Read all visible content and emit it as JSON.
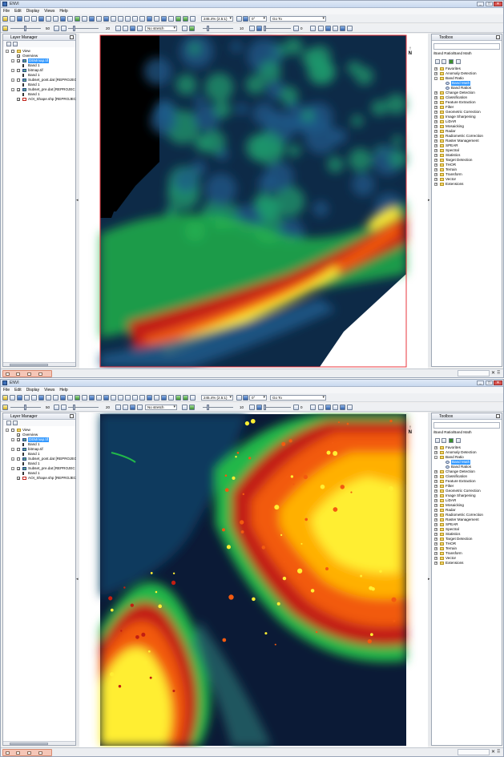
{
  "app": {
    "title": "ENVI",
    "menu": [
      "File",
      "Edit",
      "Display",
      "Views",
      "Help"
    ]
  },
  "toolbar": {
    "zoom": "245.4% (2.5:1)",
    "rotation": "0°",
    "goto_label": "Go To",
    "brightness": "50",
    "contrast": "20",
    "stretch": "No stretch",
    "sharpen": "10",
    "transparency": "0"
  },
  "layer_manager": {
    "title": "Layer Manager",
    "tree": [
      {
        "level": 0,
        "label": "View",
        "icon": "folder-icon",
        "expand": "-",
        "check": false
      },
      {
        "level": 1,
        "label": "Overview",
        "icon": "",
        "expand": "",
        "check": true
      },
      {
        "level": 1,
        "label": "DEMmap.tif",
        "icon": "raster-icon",
        "expand": "-",
        "check": true,
        "selected": true
      },
      {
        "level": 2,
        "label": "Band 1",
        "icon": "band-icon",
        "expand": "",
        "check": null
      },
      {
        "level": 1,
        "label": "bitmap.tif",
        "icon": "raster-icon",
        "expand": "-",
        "check": false
      },
      {
        "level": 2,
        "label": "Band 1",
        "icon": "band-icon",
        "expand": "",
        "check": null
      },
      {
        "level": 1,
        "label": "Subset_post.dat [REPROJEC",
        "icon": "raster-icon",
        "expand": "-",
        "check": false
      },
      {
        "level": 2,
        "label": "Band 1",
        "icon": "band-icon",
        "expand": "",
        "check": null
      },
      {
        "level": 1,
        "label": "Subset_pre.dat [REPROJEC",
        "icon": "raster-icon",
        "expand": "-",
        "check": true
      },
      {
        "level": 2,
        "label": "Band 1",
        "icon": "band-icon",
        "expand": "",
        "check": null
      },
      {
        "level": 1,
        "label": "AOI_Shape.shp [REPROJEC",
        "icon": "shape-icon",
        "expand": "",
        "check": true
      }
    ]
  },
  "toolbox": {
    "title": "Toolbox",
    "path": "/Band Ratio/Band Math",
    "tree": [
      {
        "label": "Favorites",
        "type": "folder",
        "level": 0,
        "expand": "+"
      },
      {
        "label": "Anomaly Detection",
        "type": "folder",
        "level": 0,
        "expand": "+"
      },
      {
        "label": "Band Ratio",
        "type": "folder",
        "level": 0,
        "expand": "-"
      },
      {
        "label": "Band Math",
        "type": "tool",
        "level": 1,
        "expand": "",
        "selected": true
      },
      {
        "label": "Band Ratios",
        "type": "tool",
        "level": 1,
        "expand": ""
      },
      {
        "label": "Change Detection",
        "type": "folder",
        "level": 0,
        "expand": "+"
      },
      {
        "label": "Classification",
        "type": "folder",
        "level": 0,
        "expand": "+"
      },
      {
        "label": "Feature Extraction",
        "type": "folder",
        "level": 0,
        "expand": "+"
      },
      {
        "label": "Filter",
        "type": "folder",
        "level": 0,
        "expand": "+"
      },
      {
        "label": "Geometric Correction",
        "type": "folder",
        "level": 0,
        "expand": "+"
      },
      {
        "label": "Image Sharpening",
        "type": "folder",
        "level": 0,
        "expand": "+"
      },
      {
        "label": "LiDAR",
        "type": "folder",
        "level": 0,
        "expand": "+"
      },
      {
        "label": "Mosaicking",
        "type": "folder",
        "level": 0,
        "expand": "+"
      },
      {
        "label": "Radar",
        "type": "folder",
        "level": 0,
        "expand": "+"
      },
      {
        "label": "Radiometric Correction",
        "type": "folder",
        "level": 0,
        "expand": "+"
      },
      {
        "label": "Raster Management",
        "type": "folder",
        "level": 0,
        "expand": "+"
      },
      {
        "label": "SPEAR",
        "type": "folder",
        "level": 0,
        "expand": "+"
      },
      {
        "label": "Spectral",
        "type": "folder",
        "level": 0,
        "expand": "+"
      },
      {
        "label": "Statistics",
        "type": "folder",
        "level": 0,
        "expand": "+"
      },
      {
        "label": "Target Detection",
        "type": "folder",
        "level": 0,
        "expand": "+"
      },
      {
        "label": "THOR",
        "type": "folder",
        "level": 0,
        "expand": "+"
      },
      {
        "label": "Terrain",
        "type": "folder",
        "level": 0,
        "expand": "+"
      },
      {
        "label": "Transform",
        "type": "folder",
        "level": 0,
        "expand": "+"
      },
      {
        "label": "Vector",
        "type": "folder",
        "level": 0,
        "expand": "+"
      },
      {
        "label": "Extensions",
        "type": "folder",
        "level": 0,
        "expand": "+"
      }
    ]
  },
  "view": {
    "north_label": "N"
  },
  "colors": {
    "selection": "#3399ff",
    "aoi_outline": "#e8353c",
    "ramp": [
      "#0b1a36",
      "#1f5a8a",
      "#1f9a6e",
      "#22b84a",
      "#c21e12",
      "#f25a10",
      "#ffb000",
      "#ffee33",
      "#ffffb0"
    ]
  }
}
